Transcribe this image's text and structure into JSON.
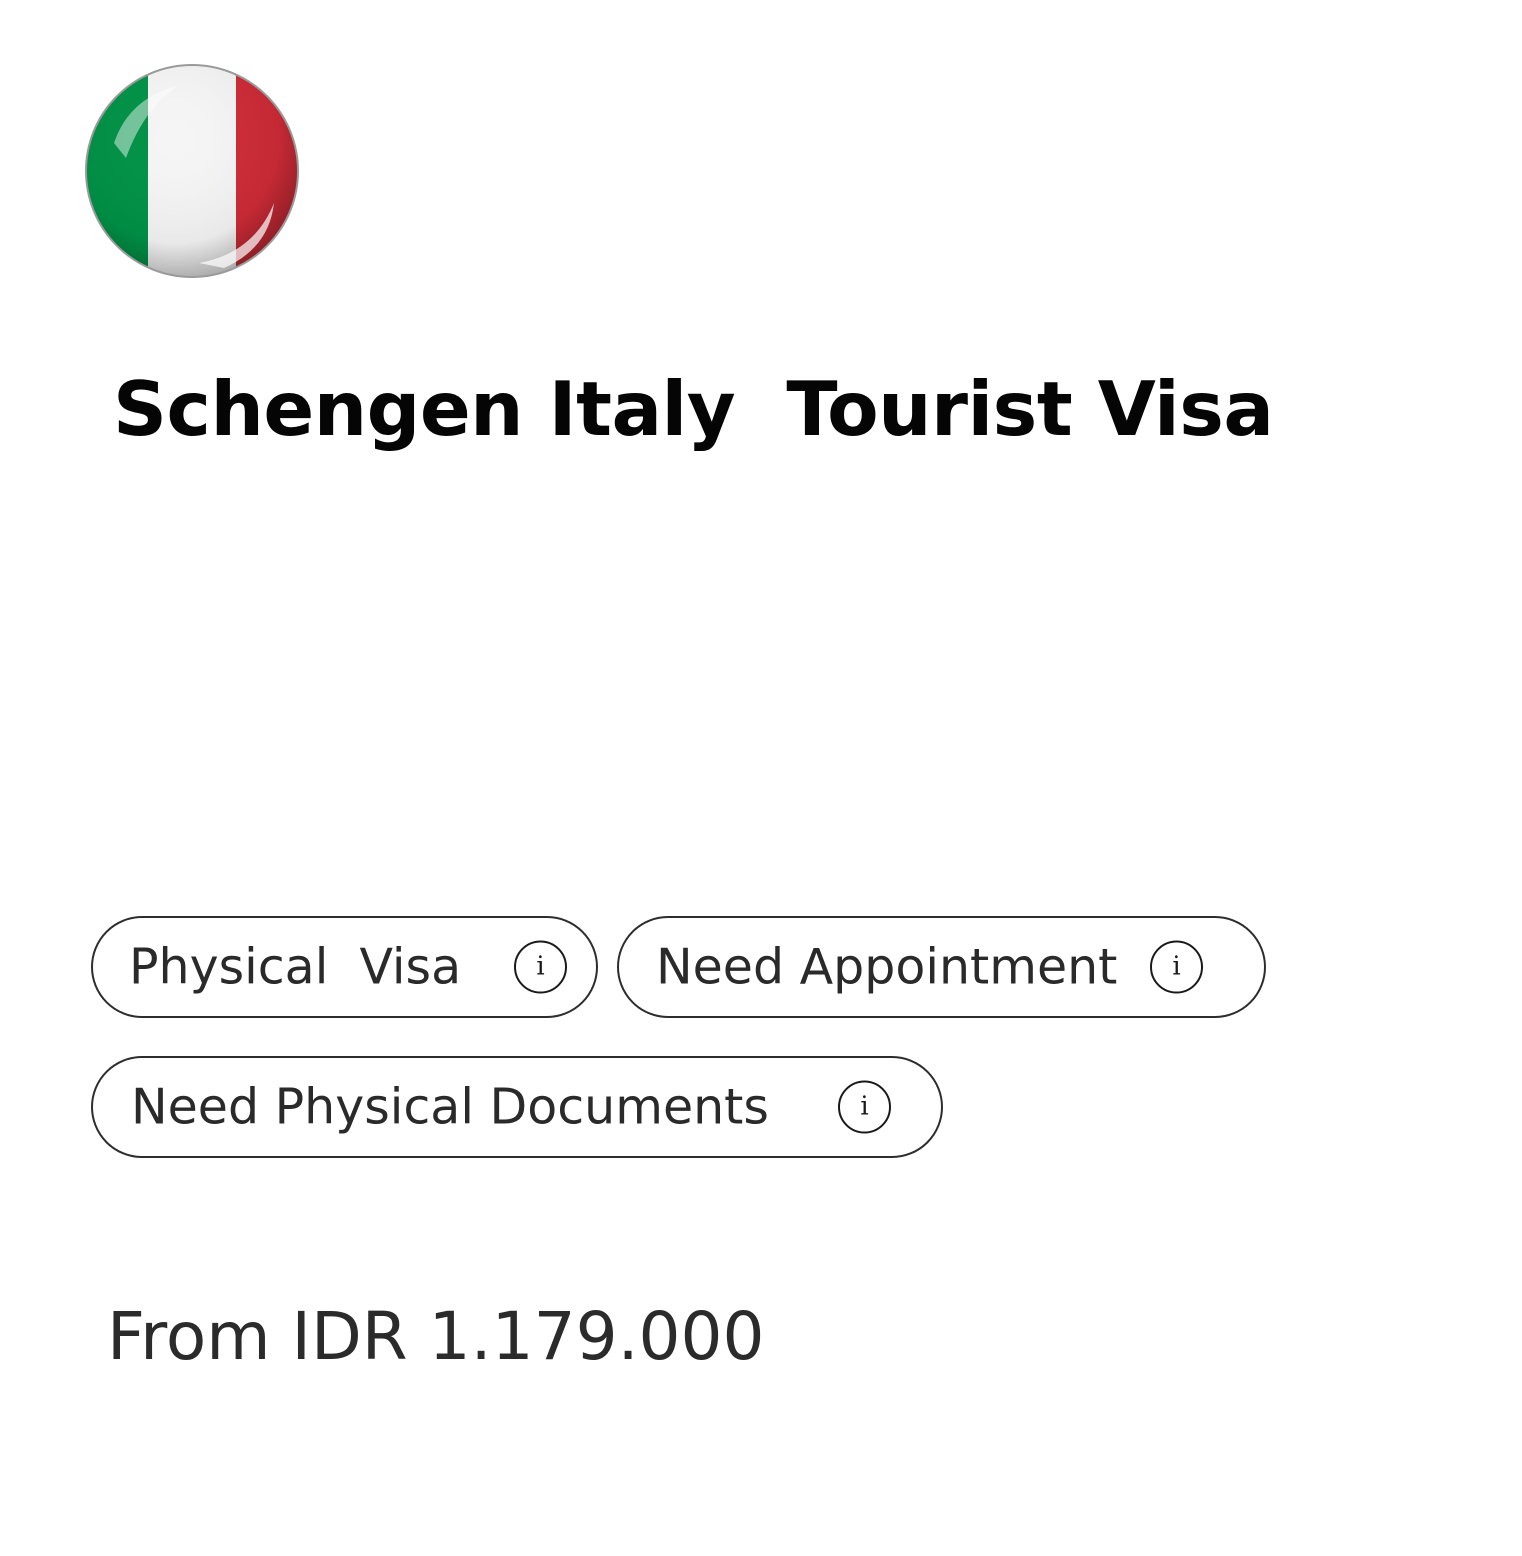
{
  "card": {
    "flag_icon": "italy-flag-icon",
    "title": "Schengen Italy  Tourist Visa",
    "features": [
      {
        "label": "Physical  Visa",
        "info_icon": "i"
      },
      {
        "label": "Need Appointment",
        "info_icon": "i"
      },
      {
        "label": "Need Physical Documents",
        "info_icon": "i"
      }
    ],
    "price": "From IDR 1.179.000"
  },
  "colors": {
    "flag_green": "#009246",
    "flag_white": "#ffffff",
    "flag_red": "#ce2b37",
    "chip_border": "#2d2d2d",
    "title_text": "#050505",
    "body_text": "#2b2b2b"
  }
}
